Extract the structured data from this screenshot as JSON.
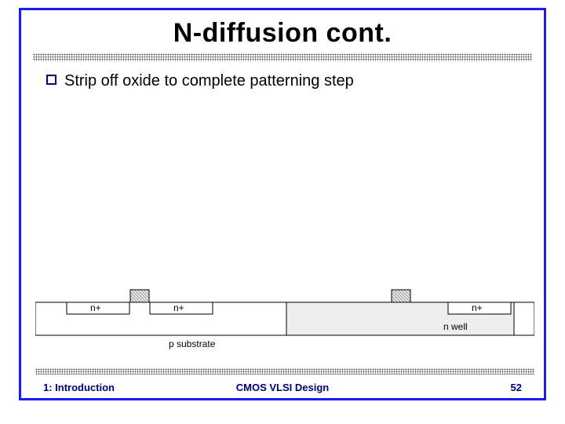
{
  "title": "N-diffusion cont.",
  "bullet": "Strip off oxide to complete patterning step",
  "diagram": {
    "nplus1": "n+",
    "nplus2": "n+",
    "nplus3": "n+",
    "nwell": "n well",
    "psubstrate": "p substrate"
  },
  "footer": {
    "left": "1: Introduction",
    "center": "CMOS VLSI Design",
    "page": "52"
  }
}
